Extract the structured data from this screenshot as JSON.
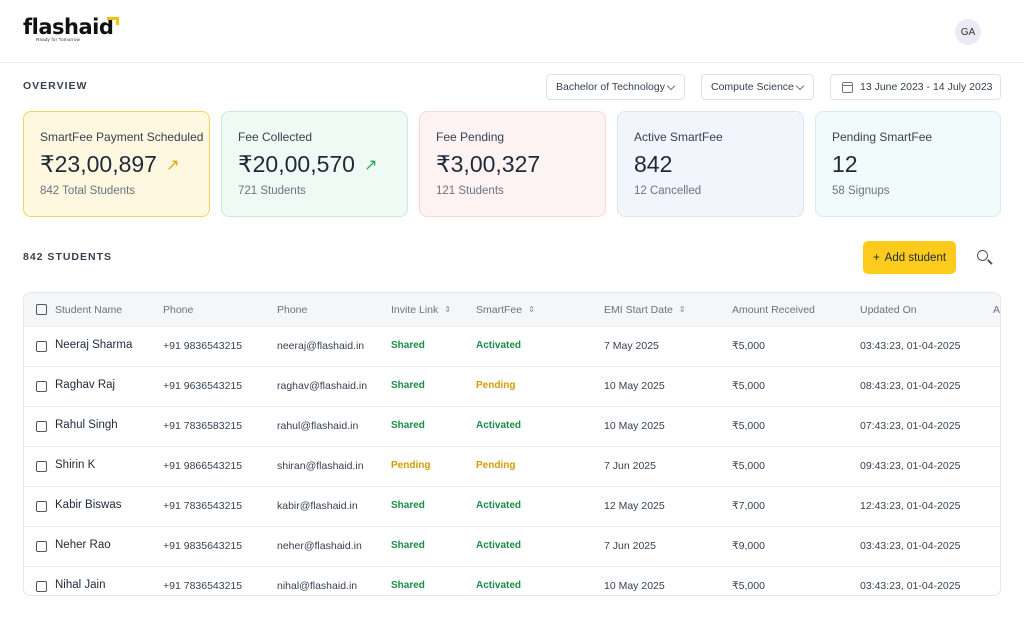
{
  "brand": {
    "name": "flashaid",
    "tagline": "Ready for Tomorrow"
  },
  "user": {
    "initials": "GA"
  },
  "overview": {
    "label": "OVERVIEW",
    "course_filter": "Bachelor of Technology",
    "dept_filter": "Compute Science",
    "date_range": "13 June 2023 - 14 July 2023"
  },
  "cards": [
    {
      "title": "SmartFee Payment Scheduled",
      "value": "₹23,00,897",
      "arrow": "↗",
      "sub": "842 Total Students"
    },
    {
      "title": "Fee Collected",
      "value": "₹20,00,570",
      "arrow": "↗",
      "sub": "721 Students"
    },
    {
      "title": "Fee Pending",
      "value": "₹3,00,327",
      "sub": "121 Students"
    },
    {
      "title": "Active SmartFee",
      "value": "842",
      "sub": "12 Cancelled"
    },
    {
      "title": "Pending SmartFee",
      "value": "12",
      "sub": "58 Signups"
    }
  ],
  "students_section": {
    "count_label": "842 STUDENTS",
    "add_button": "Add student",
    "add_icon": "+"
  },
  "table": {
    "columns": [
      "Student Name",
      "Phone",
      "Phone",
      "Invite Link",
      "SmartFee",
      "EMI Start Date",
      "Amount Received",
      "Updated On",
      "A"
    ],
    "sort_icon": "⇕",
    "rows": [
      {
        "name": "Neeraj Sharma",
        "phone": "+91 9836543215",
        "email": "neeraj@flashaid.in",
        "invite": "Shared",
        "smartfee": "Activated",
        "emi": "7 May 2025",
        "amount": "₹5,000",
        "updated": "03:43:23, 01-04-2025"
      },
      {
        "name": "Raghav Raj",
        "phone": "+91 9636543215",
        "email": "raghav@flashaid.in",
        "invite": "Shared",
        "smartfee": "Pending",
        "emi": "10 May 2025",
        "amount": "₹5,000",
        "updated": "08:43:23, 01-04-2025"
      },
      {
        "name": "Rahul Singh",
        "phone": "+91 7836583215",
        "email": "rahul@flashaid.in",
        "invite": "Shared",
        "smartfee": "Activated",
        "emi": "10 May 2025",
        "amount": "₹5,000",
        "updated": "07:43:23, 01-04-2025"
      },
      {
        "name": "Shirin K",
        "phone": "+91 9866543215",
        "email": "shiran@flashaid.in",
        "invite": "Pending",
        "smartfee": "Pending",
        "emi": "7 Jun 2025",
        "amount": "₹5,000",
        "updated": "09:43:23, 01-04-2025"
      },
      {
        "name": "Kabir Biswas",
        "phone": "+91 7836543215",
        "email": "kabir@flashaid.in",
        "invite": "Shared",
        "smartfee": "Activated",
        "emi": "12 May 2025",
        "amount": "₹7,000",
        "updated": "12:43:23, 01-04-2025"
      },
      {
        "name": "Neher Rao",
        "phone": "+91 9835643215",
        "email": "neher@flashaid.in",
        "invite": "Shared",
        "smartfee": "Activated",
        "emi": "7 Jun 2025",
        "amount": "₹9,000",
        "updated": "03:43:23, 01-04-2025"
      },
      {
        "name": "Nihal Jain",
        "phone": "+91 7836543215",
        "email": "nihal@flashaid.in",
        "invite": "Shared",
        "smartfee": "Activated",
        "emi": "10 May 2025",
        "amount": "₹5,000",
        "updated": "03:43:23, 01-04-2025"
      }
    ]
  },
  "colors": {
    "accent": "#fccb1b",
    "status_green": "#1a8c46",
    "status_amber": "#d69b00"
  }
}
